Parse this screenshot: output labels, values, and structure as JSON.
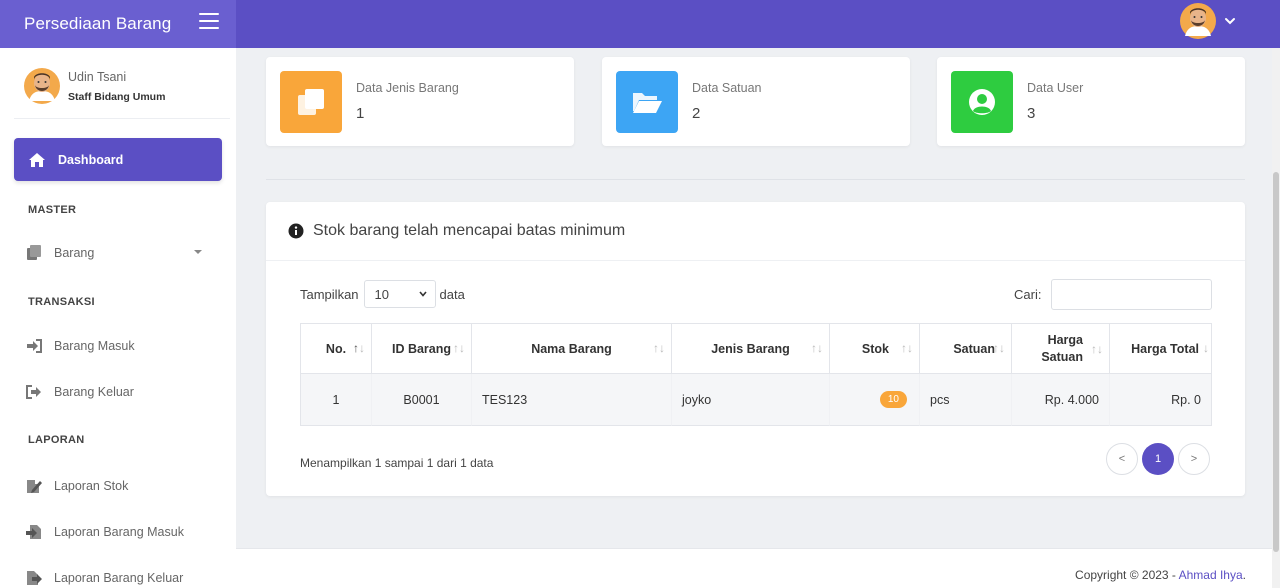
{
  "app": {
    "title": "Persediaan Barang"
  },
  "user": {
    "name": "Udin Tsani",
    "role": "Staff Bidang Umum"
  },
  "sidebar": {
    "dashboard": "Dashboard",
    "sections": {
      "master": "MASTER",
      "transaksi": "TRANSAKSI",
      "laporan": "LAPORAN"
    },
    "items": {
      "barang": "Barang",
      "barang_masuk": "Barang Masuk",
      "barang_keluar": "Barang Keluar",
      "laporan_stok": "Laporan Stok",
      "laporan_barang_masuk": "Laporan Barang Masuk",
      "laporan_barang_keluar": "Laporan Barang Keluar"
    }
  },
  "stats": [
    {
      "title": "Data Jenis Barang",
      "value": "1",
      "color": "#f9a63a",
      "icon": "copy-icon"
    },
    {
      "title": "Data Satuan",
      "value": "2",
      "color": "#3da5f4",
      "icon": "folder-open-icon"
    },
    {
      "title": "Data User",
      "value": "3",
      "color": "#2ecc40",
      "icon": "user-circle-icon"
    }
  ],
  "panel": {
    "title": "Stok barang telah mencapai batas minimum",
    "show_prefix": "Tampilkan",
    "show_value": "10",
    "show_suffix": "data",
    "search_label": "Cari:",
    "columns": [
      "No.",
      "ID Barang",
      "Nama Barang",
      "Jenis Barang",
      "Stok",
      "Satuan",
      "Harga Satuan",
      "Harga Total"
    ],
    "rows": [
      {
        "no": "1",
        "id": "B0001",
        "nama": "TES123",
        "jenis": "joyko",
        "stok": "10",
        "satuan": "pcs",
        "harga_satuan": "Rp. 4.000",
        "harga_total": "Rp. 0"
      }
    ],
    "info": "Menampilkan 1 sampai 1 dari 1 data",
    "pagination": {
      "prev": "<",
      "current": "1",
      "next": ">"
    }
  },
  "footer": {
    "copyright": "Copyright © 2023 - ",
    "author": "Ahmad Ihya",
    "period": "."
  },
  "colors": {
    "primary": "#5b4fc4",
    "brand_bg": "#6a5fd0",
    "badge": "#f9a63a"
  }
}
